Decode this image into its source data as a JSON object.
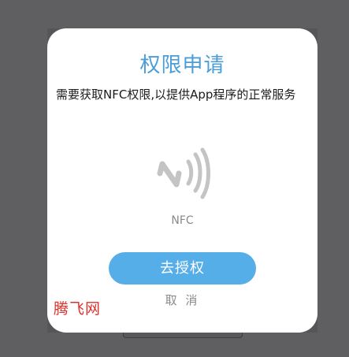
{
  "dialog": {
    "title": "权限申请",
    "message": "需要获取NFC权限,以提供App程序的正常服务",
    "icon": "nfc-icon",
    "icon_label": "NFC",
    "primary_button": "去授权",
    "cancel_label": "取 消",
    "watermark": "腾飞网"
  },
  "colors": {
    "title": "#4a9ed8",
    "primary_button": "#56aee8",
    "icon": "#c4c4c4",
    "watermark": "#e0302a",
    "overlay": "#5f5f61"
  }
}
